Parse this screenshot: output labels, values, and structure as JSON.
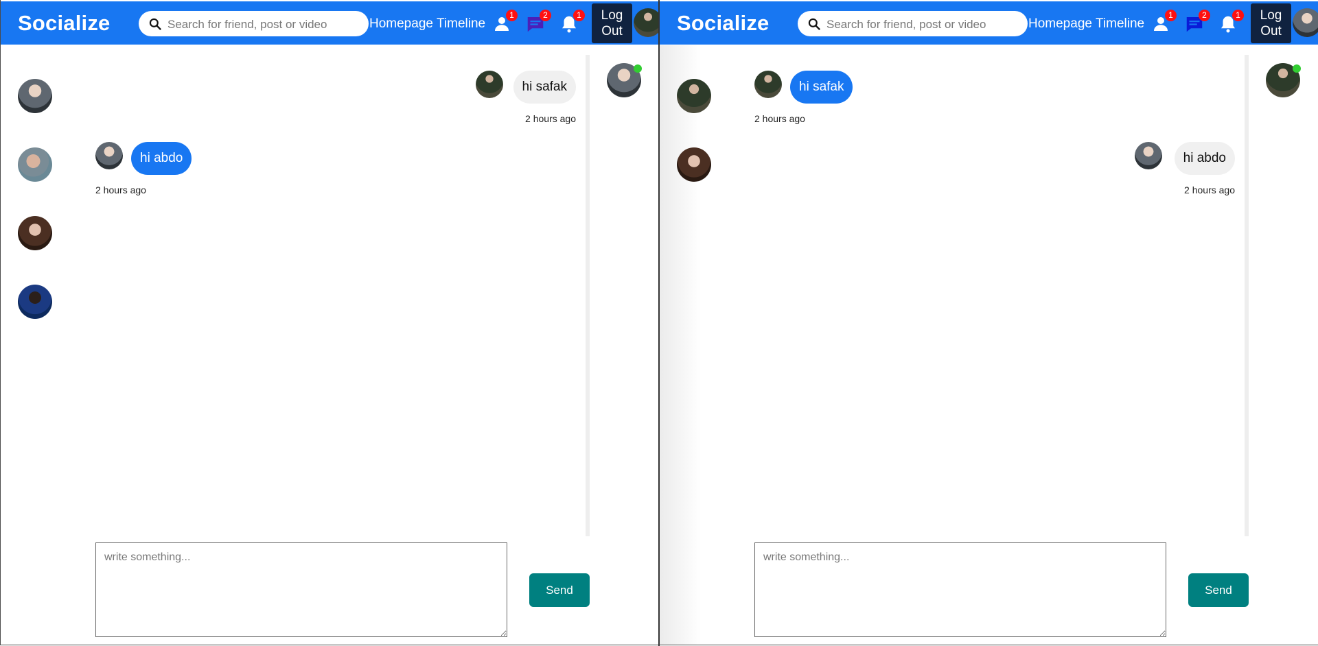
{
  "panes": [
    {
      "header": {
        "logo": "Socialize",
        "search_placeholder": "Search for friend, post or video",
        "nav_homepage": "Homepage",
        "nav_timeline": "Timeline",
        "friend_requests_count": "1",
        "messages_count": "2",
        "notifications_count": "1",
        "logout_line1": "Log",
        "logout_line2": "Out"
      },
      "messages": [
        {
          "text": "hi safak",
          "time": "2 hours ago",
          "own": false
        },
        {
          "text": "hi abdo",
          "time": "2 hours ago",
          "own": true
        }
      ],
      "composer_placeholder": "write something...",
      "send_label": "Send"
    },
    {
      "header": {
        "logo": "Socialize",
        "search_placeholder": "Search for friend, post or video",
        "nav_homepage": "Homepage",
        "nav_timeline": "Timeline",
        "friend_requests_count": "1",
        "messages_count": "2",
        "notifications_count": "1",
        "logout_line1": "Log",
        "logout_line2": "Out"
      },
      "messages": [
        {
          "text": "hi safak",
          "time": "2 hours ago",
          "own": true
        },
        {
          "text": "hi abdo",
          "time": "2 hours ago",
          "own": false
        }
      ],
      "composer_placeholder": "write something...",
      "send_label": "Send"
    }
  ],
  "colors": {
    "brand": "#1877f2",
    "badge": "#ff1010",
    "logout_bg": "#10223f",
    "send": "#008080",
    "online": "#32cd32",
    "own_bubble": "#1877f2",
    "other_bubble": "#f0f0f0",
    "messages_icon": "#4b1fb8"
  },
  "icons": {
    "search": "search-icon",
    "friends": "person-icon",
    "messages": "chat-icon",
    "notifications": "bell-icon"
  }
}
